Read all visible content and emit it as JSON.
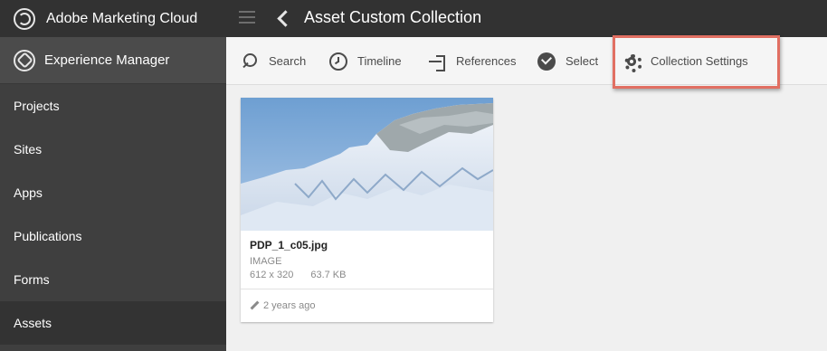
{
  "topbar": {
    "brand_title": "Adobe Marketing Cloud",
    "page_title": "Asset Custom Collection"
  },
  "sidebar": {
    "header_label": "Experience Manager",
    "items": [
      {
        "label": "Projects"
      },
      {
        "label": "Sites"
      },
      {
        "label": "Apps"
      },
      {
        "label": "Publications"
      },
      {
        "label": "Forms"
      },
      {
        "label": "Assets",
        "active": true
      }
    ]
  },
  "actionbar": {
    "items": [
      {
        "label": "Search",
        "icon": "search-icon"
      },
      {
        "label": "Timeline",
        "icon": "clock-icon"
      },
      {
        "label": "References",
        "icon": "references-icon"
      },
      {
        "label": "Select",
        "icon": "check-circle-icon"
      },
      {
        "label": "Collection Settings",
        "icon": "gear-icon"
      }
    ],
    "highlight_color": "#e16f62"
  },
  "asset_card": {
    "name": "PDP_1_c05.jpg",
    "type": "IMAGE",
    "dimensions": "612 x 320",
    "size": "63.7 KB",
    "modified": "2 years ago"
  },
  "colors": {
    "topbar_bg": "#323232",
    "sidebar_bg": "#3f3f3f",
    "content_bg": "#f0f0f0"
  }
}
